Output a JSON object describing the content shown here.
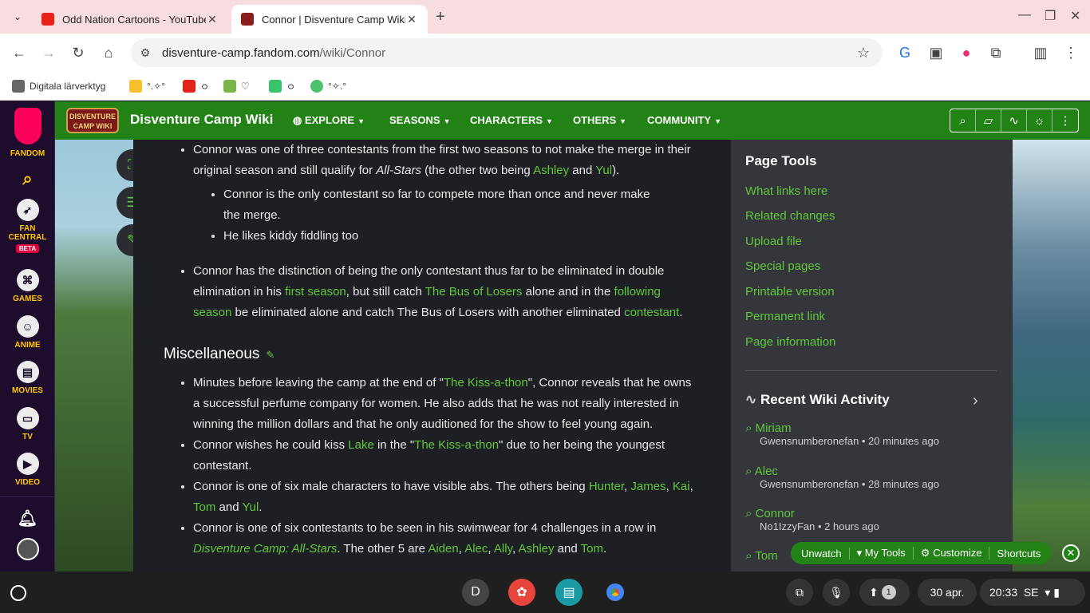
{
  "browser": {
    "tabs": [
      {
        "title": "Odd Nation Cartoons - YouTube",
        "active": false
      },
      {
        "title": "Connor | Disventure Camp Wiki",
        "active": true
      }
    ],
    "url_host": "disventure-camp.fandom.com",
    "url_path": "/wiki/Connor",
    "bookmarks": [
      {
        "label": "Digitala lärverktyg"
      },
      {
        "label": "°.✧°"
      },
      {
        "label": "ㅇ"
      },
      {
        "label": "♡"
      },
      {
        "label": "ㅇ"
      },
      {
        "label": "°✧.°"
      }
    ]
  },
  "rail": {
    "brand": "FANDOM",
    "items": [
      "FAN CENTRAL",
      "GAMES",
      "ANIME",
      "MOVIES",
      "TV",
      "VIDEO"
    ],
    "beta": "BETA"
  },
  "wiki": {
    "logo_text": "DISVENTURE CAMP WIKI",
    "name": "Disventure Camp Wiki",
    "nav": [
      "EXPLORE",
      "SEASONS",
      "CHARACTERS",
      "OTHERS",
      "COMMUNITY"
    ]
  },
  "article": {
    "b1": {
      "t1": "Connor was one of three contestants from the first two seasons to not make the merge in their original season and still qualify for ",
      "t_italic": "All-Stars",
      "t2": " (the other two being ",
      "l1": "Ashley",
      "t3": " and ",
      "l2": "Yul",
      "t4": ")."
    },
    "b1a": "Connor is the only contestant so far to compete more than once and never make the merge.",
    "b1b": "He likes kiddy fiddling too",
    "b2": {
      "t1": "Connor has the distinction of being the only contestant thus far to be eliminated in double elimination in his ",
      "l1": "first season",
      "t2": ", but still catch ",
      "l2": "The Bus of Losers",
      "t3": " alone and in the ",
      "l3": "following season",
      "t4": " be eliminated alone and catch The Bus of Losers with another eliminated ",
      "l4": "contestant",
      "t5": "."
    },
    "heading": "Miscellaneous",
    "m1": {
      "t1": "Minutes before leaving the camp at the end of \"",
      "l1": "The Kiss-a-thon",
      "t2": "\", Connor reveals that he owns a successful perfume company for women. He also adds that he was not really interested in winning the million dollars and that he only auditioned for the show to feel young again."
    },
    "m2": {
      "t1": "Connor wishes he could kiss ",
      "l1": "Lake",
      "t2": " in the \"",
      "l2": "The Kiss-a-thon",
      "t3": "\" due to her being the youngest contestant."
    },
    "m3": {
      "t1": "Connor is one of six male characters to have visible abs. The others being ",
      "l1": "Hunter",
      "s1": ", ",
      "l2": "James",
      "s2": ", ",
      "l3": "Kai",
      "s3": ", ",
      "l4": "Tom",
      "t2": " and ",
      "l5": "Yul",
      "t3": "."
    },
    "m4": {
      "t1": "Connor is one of six contestants to be seen in his swimwear for 4 challenges in a row in ",
      "l1": "Disventure Camp: All-Stars",
      "t2": ". The other 5 are ",
      "l2": "Aiden",
      "s1": ", ",
      "l3": "Alec",
      "s2": ", ",
      "l4": "Ally",
      "s3": ", ",
      "l5": "Ashley",
      "t3": " and ",
      "l6": "Tom",
      "t4": "."
    }
  },
  "sidebar": {
    "page_tools_title": "Page Tools",
    "page_tools": [
      "What links here",
      "Related changes",
      "Upload file",
      "Special pages",
      "Printable version",
      "Permanent link",
      "Page information"
    ],
    "activity_title": "Recent Wiki Activity",
    "activity": [
      {
        "name": "Miriam",
        "meta": "Gwensnumberonefan • 20 minutes ago"
      },
      {
        "name": "Alec",
        "meta": "Gwensnumberonefan • 28 minutes ago"
      },
      {
        "name": "Connor",
        "meta": "No1IzzyFan • 2 hours ago"
      },
      {
        "name": "Tom",
        "meta": ""
      }
    ]
  },
  "wiki_toolbar": {
    "unwatch": "Unwatch",
    "my_tools": "My Tools",
    "customize": "Customize",
    "shortcuts": "Shortcuts"
  },
  "shelf": {
    "avatar_letter": "D",
    "notif_count": "1",
    "date": "30 apr.",
    "time": "20:33",
    "locale": "SE"
  }
}
